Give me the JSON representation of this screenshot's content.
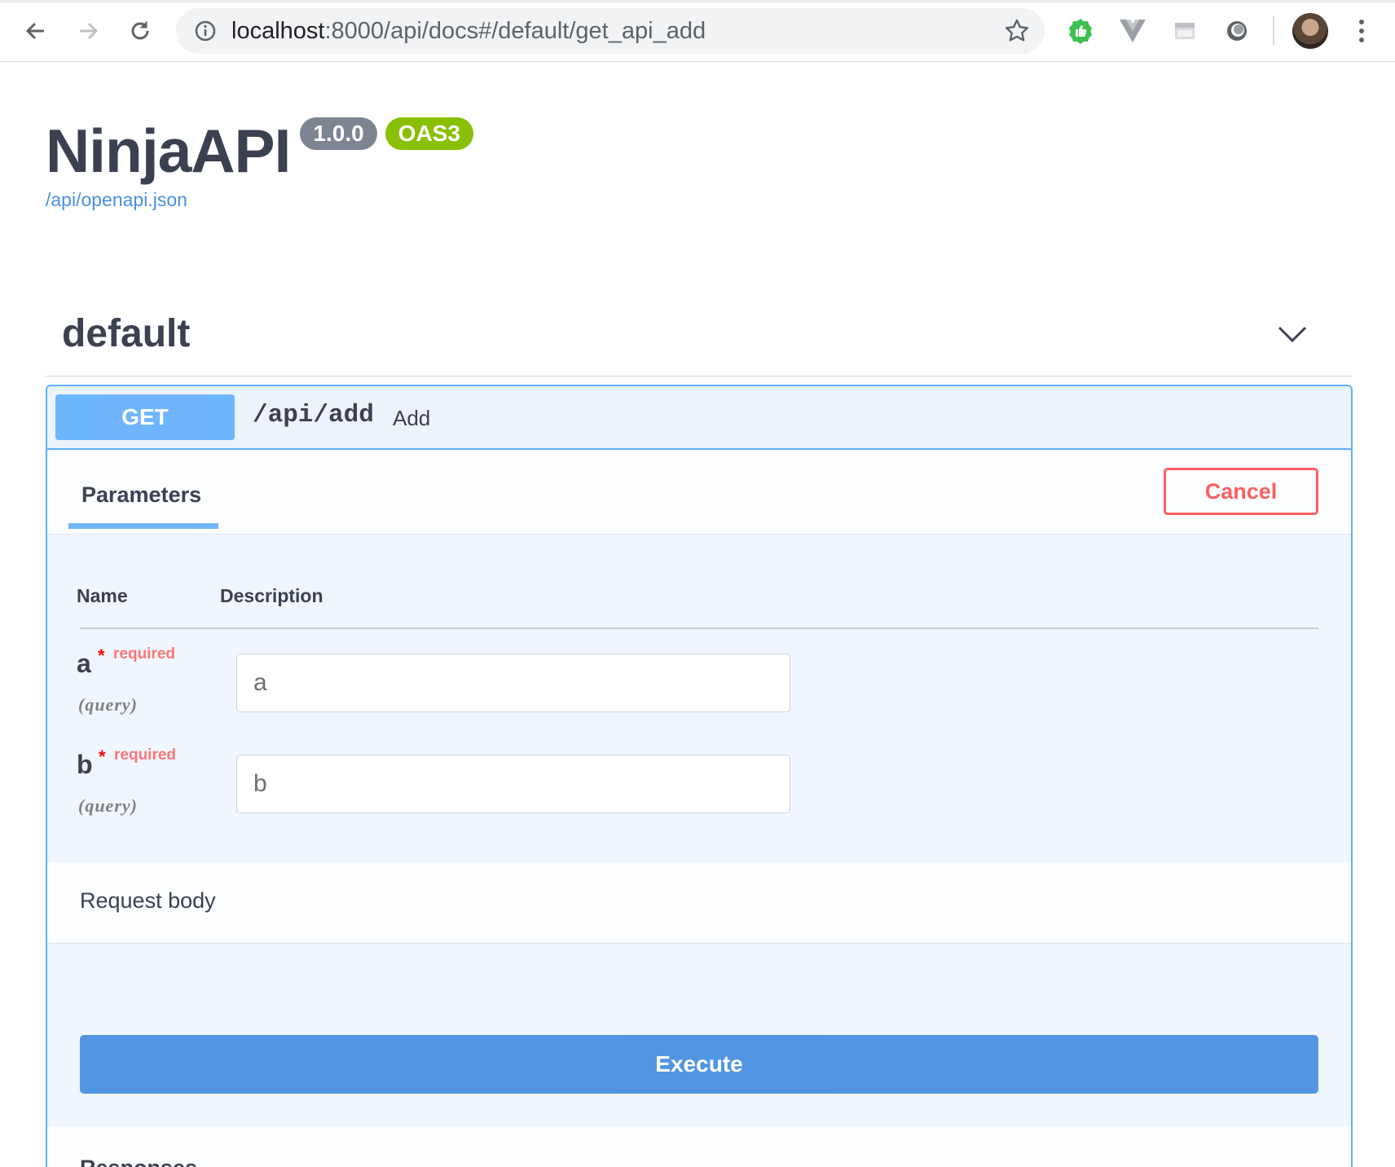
{
  "browser": {
    "url_host": "localhost",
    "url_rest": ":8000/api/docs#/default/get_api_add"
  },
  "info": {
    "title": "NinjaAPI",
    "version": "1.0.0",
    "oas": "OAS3",
    "spec_link": "/api/openapi.json"
  },
  "tag": {
    "name": "default"
  },
  "operation": {
    "method": "GET",
    "path": "/api/add",
    "summary": "Add",
    "parameters_tab": "Parameters",
    "cancel_label": "Cancel",
    "columns": [
      "Name",
      "Description"
    ],
    "params": [
      {
        "name": "a",
        "star": "*",
        "required": "required",
        "in": "(query)",
        "placeholder": "a"
      },
      {
        "name": "b",
        "star": "*",
        "required": "required",
        "in": "(query)",
        "placeholder": "b"
      }
    ],
    "request_body_label": "Request body",
    "execute_label": "Execute",
    "responses_label": "Responses"
  },
  "colors": {
    "get": "#61affe",
    "cancel": "#ff6060",
    "execute": "#4990e2",
    "oas_badge": "#89bf04",
    "version_badge": "#7d8492"
  }
}
